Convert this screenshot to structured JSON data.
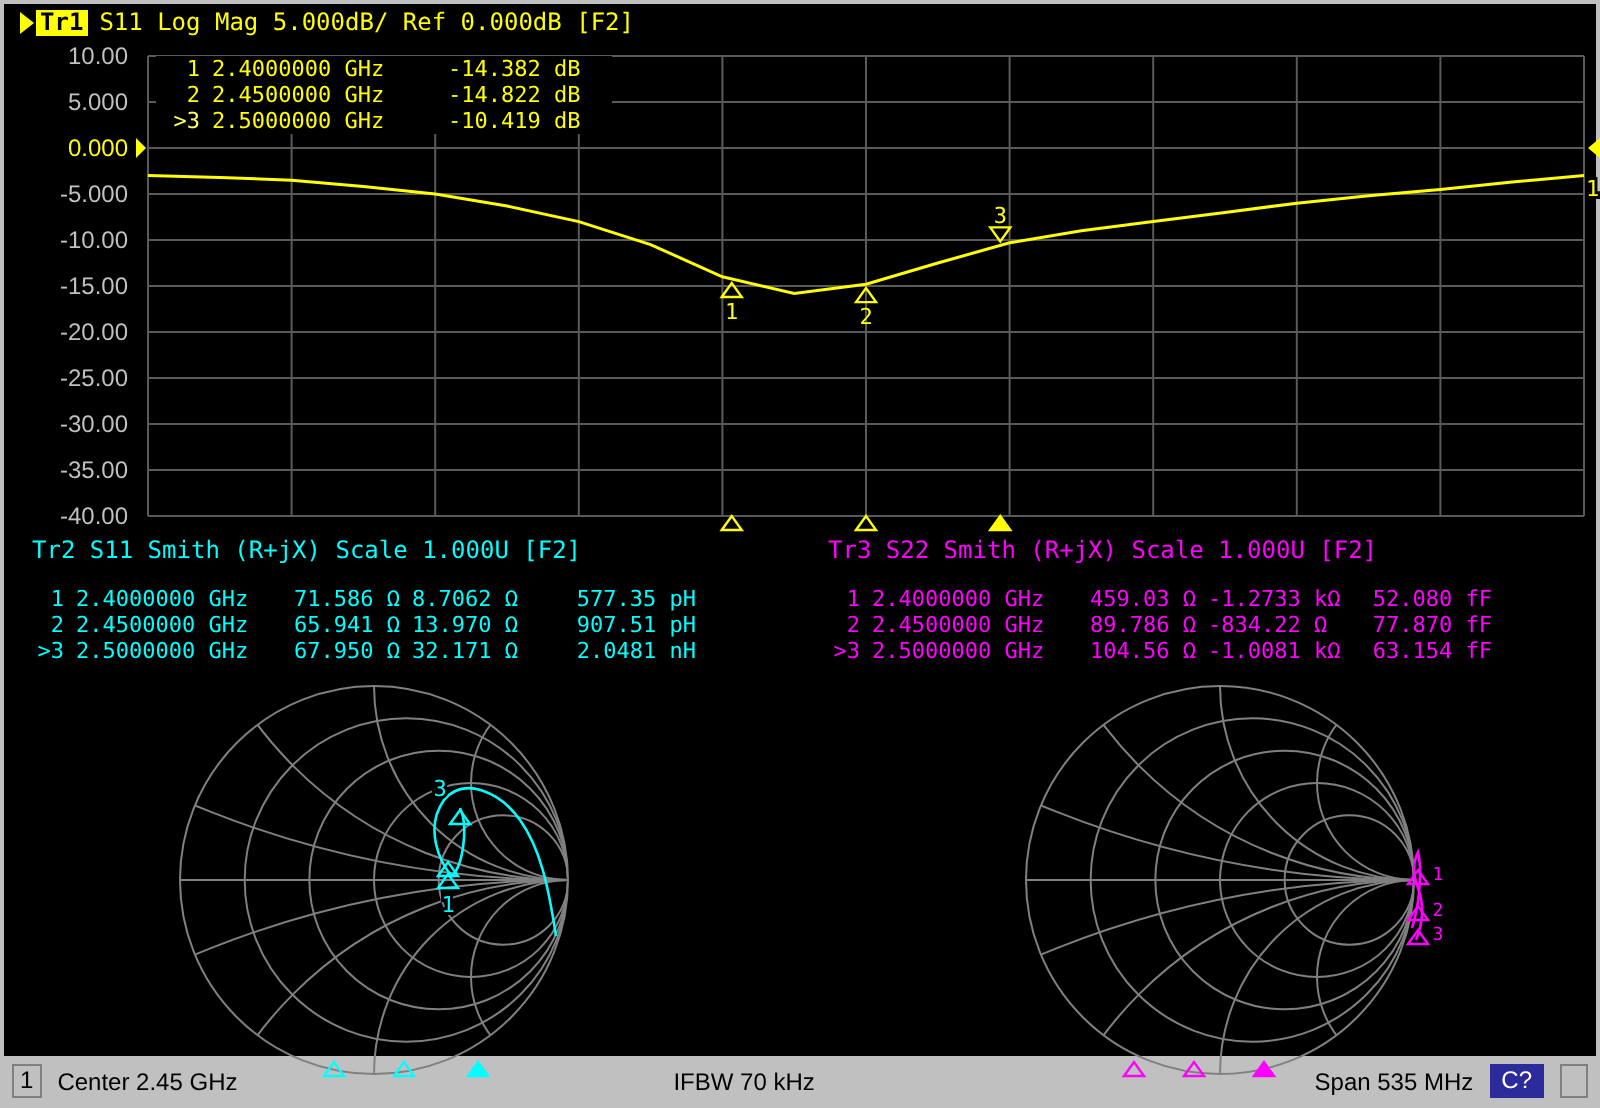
{
  "trace1": {
    "label": "Tr1",
    "title": "S11 Log Mag 5.000dB/ Ref 0.000dB [F2]",
    "ref_marker": "1",
    "markers": [
      {
        "id": "1",
        "frequency": "2.4000000 GHz",
        "value": "-14.382 dB",
        "selected": false,
        "flag": "1"
      },
      {
        "id": "2",
        "frequency": "2.4500000 GHz",
        "value": "-14.822 dB",
        "selected": false,
        "flag": "2"
      },
      {
        "id": ">3",
        "frequency": "2.5000000 GHz",
        "value": "-10.419 dB",
        "selected": true,
        "flag": "3"
      }
    ],
    "chart_data": {
      "type": "line",
      "categories": [
        null,
        null,
        null,
        null,
        null,
        null,
        null,
        null,
        null,
        null,
        null,
        null,
        null,
        null,
        null,
        null,
        null,
        null,
        null,
        null,
        null
      ],
      "series": [
        {
          "color": "#ffff00",
          "values": [
            -3.0,
            -3.2,
            -3.5,
            -4.2,
            -5.0,
            -6.3,
            -8.0,
            -10.5,
            -14.0,
            -15.8,
            -14.8,
            -12.5,
            -10.3,
            -9.0,
            -8.0,
            -7.0,
            -6.0,
            -5.2,
            -4.5,
            -3.7,
            -3.0
          ]
        }
      ],
      "ylim": [
        -40,
        10
      ],
      "grid": true,
      "yticks": [
        {
          "value": 10,
          "label": "10.00"
        },
        {
          "value": 5,
          "label": "5.000"
        },
        {
          "value": 0,
          "label": "0.000"
        },
        {
          "value": -5,
          "label": "-5.000"
        },
        {
          "value": -10,
          "label": "-10.00"
        },
        {
          "value": -15,
          "label": "-15.00"
        },
        {
          "value": -20,
          "label": "-20.00"
        },
        {
          "value": -25,
          "label": "-25.00"
        },
        {
          "value": -30,
          "label": "-30.00"
        },
        {
          "value": -35,
          "label": "-35.00"
        },
        {
          "value": -40,
          "label": "-40.00"
        }
      ]
    }
  },
  "smith_panels": [
    {
      "title": "Tr2 S11 Smith (R+jX) Scale 1.000U [F2]",
      "color": "#00ffff",
      "markers": [
        {
          "id": "1",
          "frequency": "2.4000000 GHz",
          "resistance": "71.586 Ω",
          "reactance": "8.7062 Ω",
          "equivalent": "577.35 pH",
          "selected": false,
          "flag": "1"
        },
        {
          "id": "2",
          "frequency": "2.4500000 GHz",
          "resistance": "65.941 Ω",
          "reactance": "13.970 Ω",
          "equivalent": "907.51 pH",
          "selected": false
        },
        {
          "id": ">3",
          "frequency": "2.5000000 GHz",
          "resistance": "67.950 Ω",
          "reactance": "32.171 Ω",
          "equivalent": "2.0481 nH",
          "selected": true,
          "flag": "3"
        }
      ]
    },
    {
      "title": "Tr3 S22 Smith (R+jX) Scale 1.000U [F2]",
      "color": "#ff00ff",
      "markers": [
        {
          "id": "1",
          "frequency": "2.4000000 GHz",
          "resistance": "459.03 Ω",
          "reactance": "-1.2733 kΩ",
          "equivalent": "52.080 fF",
          "selected": false,
          "flag": "1"
        },
        {
          "id": "2",
          "frequency": "2.4500000 GHz",
          "resistance": "89.786 Ω",
          "reactance": "-834.22 Ω",
          "equivalent": "77.870 fF",
          "selected": false,
          "flag": "2"
        },
        {
          "id": ">3",
          "frequency": "2.5000000 GHz",
          "resistance": "104.56 Ω",
          "reactance": "-1.0081 kΩ",
          "equivalent": "63.154 fF",
          "selected": true,
          "flag": "3"
        }
      ]
    }
  ],
  "status_bar": {
    "channel": "1",
    "center": "Center 2.45 GHz",
    "ifbw": "IFBW 70 kHz",
    "span": "Span 535 MHz",
    "button": "C?"
  }
}
